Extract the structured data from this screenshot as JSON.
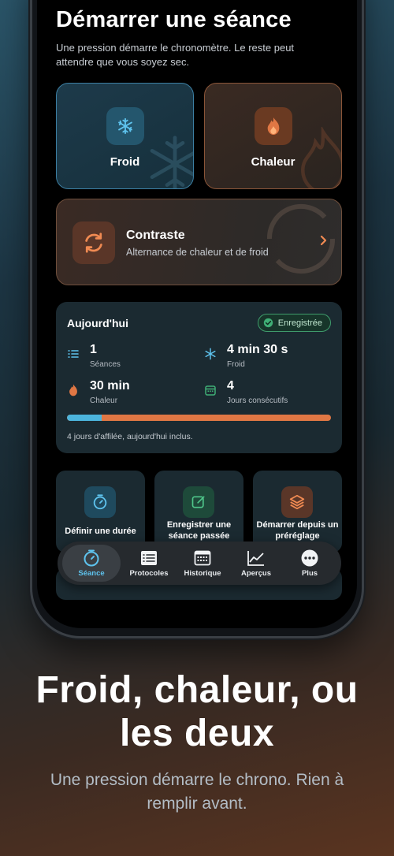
{
  "page": {
    "title": "Démarrer une séance",
    "subtitle": "Une pression démarre le chronomètre. Le reste peut attendre que vous soyez sec."
  },
  "modes": {
    "cold": {
      "label": "Froid",
      "icon": "snowflake-icon",
      "color": "#4cb4dc"
    },
    "heat": {
      "label": "Chaleur",
      "icon": "flame-icon",
      "color": "#e07744"
    },
    "contrast": {
      "title": "Contraste",
      "subtitle": "Alternance de chaleur et de froid",
      "icon": "cycle-arrows-icon"
    }
  },
  "today": {
    "title": "Aujourd'hui",
    "badge": "Enregistrée",
    "stats": [
      {
        "value": "1",
        "label": "Séances",
        "icon": "list-icon"
      },
      {
        "value": "4 min 30 s",
        "label": "Froid",
        "icon": "snowflake-icon"
      },
      {
        "value": "30 min",
        "label": "Chaleur",
        "icon": "flame-icon"
      },
      {
        "value": "4",
        "label": "Jours consécutifs",
        "icon": "calendar-icon"
      }
    ],
    "cold_fraction": 0.13,
    "note": "4 jours d'affilée, aujourd'hui inclus."
  },
  "actions": [
    {
      "label": "Définir une durée",
      "icon": "timer-icon"
    },
    {
      "label": "Enregistrer une séance passée",
      "icon": "edit-icon"
    },
    {
      "label": "Démarrer depuis un préréglage",
      "icon": "layers-icon"
    }
  ],
  "tabs": [
    {
      "label": "Séance",
      "icon": "timer-icon",
      "active": true
    },
    {
      "label": "Protocoles",
      "icon": "list-icon"
    },
    {
      "label": "Historique",
      "icon": "calendar-icon"
    },
    {
      "label": "Aperçus",
      "icon": "chart-icon"
    },
    {
      "label": "Plus",
      "icon": "more-icon"
    }
  ],
  "marketing": {
    "headline_line1": "Froid, chaleur, ou",
    "headline_line2": "les deux",
    "tagline": "Une pression démarre le chrono. Rien à remplir avant."
  },
  "colors": {
    "accent_blue": "#5ec3ee",
    "accent_orange": "#e07744",
    "success_green": "#3f9c6c"
  }
}
